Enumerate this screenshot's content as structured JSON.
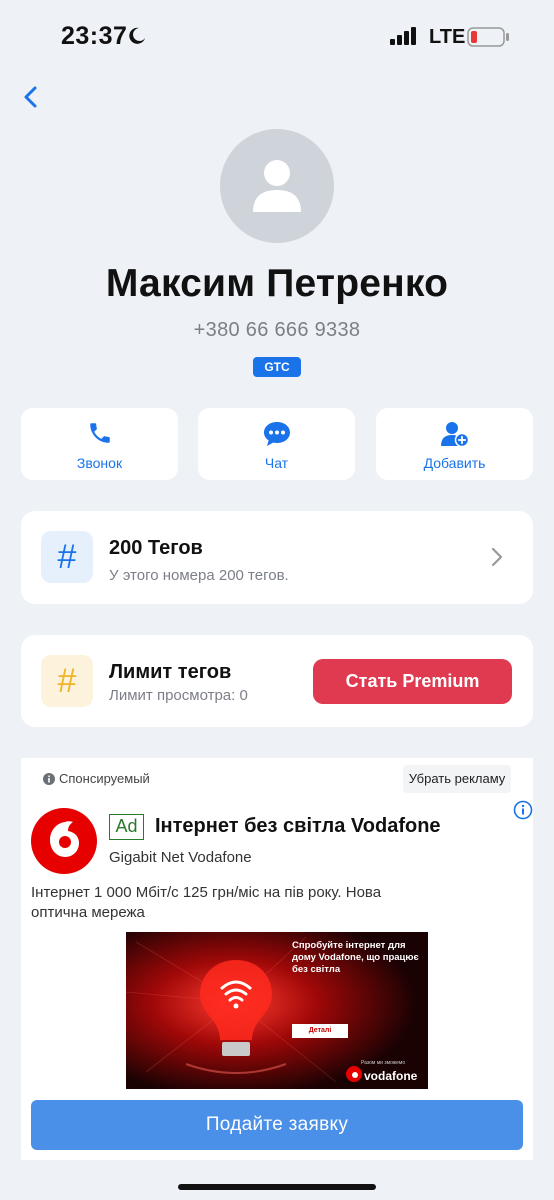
{
  "status_bar": {
    "time": "23:37",
    "network": "LTE"
  },
  "contact": {
    "name": "Максим Петренко",
    "phone": "+380 66 666 9338",
    "badge": "GTC"
  },
  "actions": [
    {
      "label": "Звонок",
      "icon": "phone-icon"
    },
    {
      "label": "Чат",
      "icon": "chat-icon"
    },
    {
      "label": "Добавить",
      "icon": "add-contact-icon"
    }
  ],
  "tags_card": {
    "title": "200 Тегов",
    "subtitle": "У этого номера 200 тегов.",
    "icon": "hash-icon"
  },
  "limit_card": {
    "title": "Лимит тегов",
    "subtitle": "Лимит просмотра: 0",
    "button": "Стать Premium",
    "icon": "hash-icon"
  },
  "ad": {
    "sponsored_label": "Спонсируемый",
    "remove_label": "Убрать рекламу",
    "ad_tag": "Ad",
    "title": "Інтернет без світла Vodafone",
    "advertiser": "Gigabit Net Vodafone",
    "body": "Інтернет 1 000 Мбіт/с 125 грн/міс на пів року. Нова оптична мережа",
    "banner": {
      "headline": "Спробуйте інтернет для дому Vodafone, що працює без світла",
      "button": "Деталі",
      "small_text": "Разом ми зможемо",
      "brand": "vodafone"
    },
    "cta": "Подайте заявку"
  },
  "colors": {
    "accent": "#1a73e8",
    "premium": "#e03a50",
    "cta": "#4a8fe8",
    "background": "#eef1f6"
  }
}
